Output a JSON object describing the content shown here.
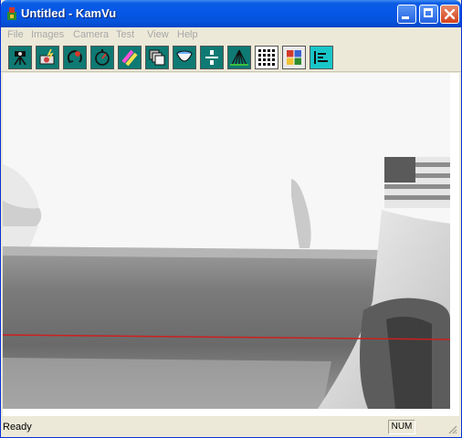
{
  "window": {
    "title": "Untitled - KamVu",
    "title_color": "#0656e6",
    "controls": [
      "minimize-icon",
      "maximize-icon",
      "close-icon"
    ]
  },
  "menu": {
    "items": [
      {
        "label": "File"
      },
      {
        "label": "Images"
      },
      {
        "label": "Camera"
      },
      {
        "label": "Test"
      },
      {
        "label": "View"
      },
      {
        "label": "Help"
      }
    ],
    "disabled_color": "#a8a8a8"
  },
  "toolbar": {
    "buttons": [
      {
        "icon": "camera-tripod-icon"
      },
      {
        "icon": "capture-flash-icon"
      },
      {
        "icon": "rotate-camera-icon"
      },
      {
        "icon": "clock-gauge-icon"
      },
      {
        "icon": "color-pencils-icon"
      },
      {
        "icon": "image-stack-icon"
      },
      {
        "icon": "lens-icon"
      },
      {
        "icon": "fraction-icon"
      },
      {
        "icon": "perspective-grid-icon"
      },
      {
        "icon": "dot-grid-icon"
      },
      {
        "icon": "color-table-icon"
      },
      {
        "icon": "histogram-icon",
        "active": true
      }
    ],
    "accent": "#0e7a73",
    "active_accent": "#18c6c8"
  },
  "statusbar": {
    "text": "Ready",
    "num_indicator": "NUM"
  },
  "video": {
    "line_color": "#cc1f1f"
  }
}
